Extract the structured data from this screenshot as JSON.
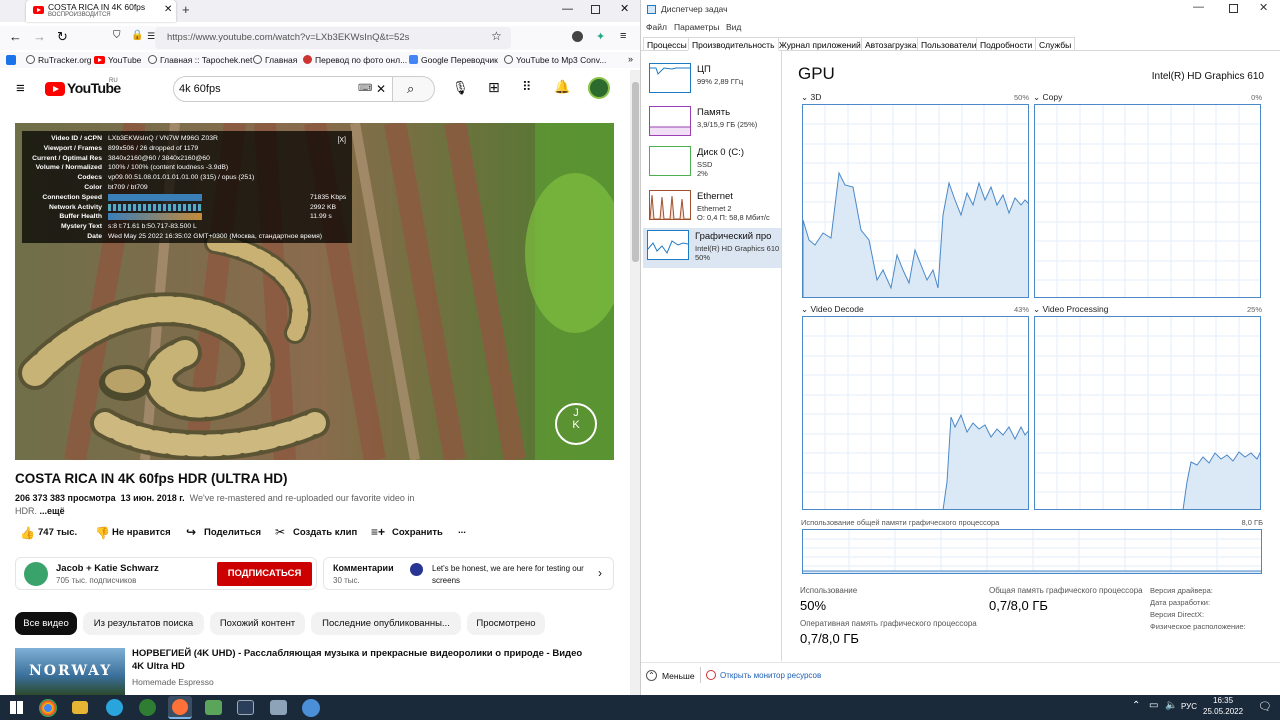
{
  "browser": {
    "tab_title": "COSTA RICA IN 4K 60fps HDR (",
    "tab_subtitle": "ВОСПРОИЗВОДИТСЯ",
    "url": "https://www.youtube.com/watch?v=LXb3EKWsInQ&t=52s",
    "bookmarks": [
      "RuTracker.org",
      "YouTube",
      "Главная :: Tapochek.net",
      "Главная",
      "Перевод по фото онл...",
      "Google Переводчик",
      "YouTube to Mp3 Conv..."
    ]
  },
  "youtube": {
    "logo": "YouTube",
    "logo_region": "RU",
    "search_value": "4k 60fps",
    "stats": [
      {
        "k": "Video ID / sCPN",
        "v": "LXb3EKWsInQ / VN7W M96G Z03R"
      },
      {
        "k": "Viewport / Frames",
        "v": "899x506 / 26 dropped of 1179"
      },
      {
        "k": "Current / Optimal Res",
        "v": "3840x2160@60 / 3840x2160@60"
      },
      {
        "k": "Volume / Normalized",
        "v": "100% / 100% (content loudness -3.9dB)"
      },
      {
        "k": "Codecs",
        "v": "vp09.00.51.08.01.01.01.01.00 (315) / opus (251)"
      },
      {
        "k": "Color",
        "v": "bt709 / bt709"
      },
      {
        "k": "Connection Speed",
        "v": "71835 Kbps"
      },
      {
        "k": "Network Activity",
        "v": "2992 KB"
      },
      {
        "k": "Buffer Health",
        "v": "11.99 s"
      },
      {
        "k": "Mystery Text",
        "v": "s:8 t:71.61 b:50.717-83.500 L"
      },
      {
        "k": "Date",
        "v": "Wed May 25 2022 16:35:02 GMT+0300 (Москва, стандартное время)"
      }
    ],
    "stats_close": "[X]",
    "watermark": "J K",
    "title": "COSTA RICA IN 4K 60fps HDR (ULTRA HD)",
    "views": "206 373 383 просмотра",
    "date": "13 июн. 2018 г.",
    "desc": "We've re-mastered and re-uploaded our favorite video in",
    "desc2": "HDR.",
    "more": "...ещё",
    "likes": "747 тыс.",
    "dislike": "Не нравится",
    "share": "Поделиться",
    "clip": "Создать клип",
    "save": "Сохранить",
    "more_dots": "...",
    "channel": "Jacob + Katie Schwarz",
    "subs": "705 тыс. подписчиков",
    "subscribe": "ПОДПИСАТЬСЯ",
    "comments_label": "Комментарии",
    "comments_count": "30 тыс.",
    "comment_text": "Let's be honest, we are here for testing our screens",
    "chips": [
      "Все видео",
      "Из результатов поиска",
      "Похожий контент",
      "Последние опубликованны...",
      "Просмотрено"
    ],
    "rec_title": "НОРВЕГИЕЙ (4K UHD) - Расслабляющая музыка и прекрасные видеоролики о природе - Видео 4K Ultra HD",
    "rec_channel": "Homemade Espresso",
    "rec_thumb_text": "NORWAY"
  },
  "taskmanager": {
    "title": "Диспетчер задач",
    "menu": [
      "Файл",
      "Параметры",
      "Вид"
    ],
    "tabs": [
      "Процессы",
      "Производительность",
      "Журнал приложений",
      "Автозагрузка",
      "Пользователи",
      "Подробности",
      "Службы"
    ],
    "side": [
      {
        "name": "ЦП",
        "s1": "99% 2,89 ГГц",
        "s2": "",
        "color": "#1f7ac4"
      },
      {
        "name": "Память",
        "s1": "3,9/15,9 ГБ (25%)",
        "s2": "",
        "color": "#9b3fb5"
      },
      {
        "name": "Диск 0 (C:)",
        "s1": "SSD",
        "s2": "2%",
        "color": "#4caf50"
      },
      {
        "name": "Ethernet",
        "s1": "Ethernet 2",
        "s2": "О: 0,4 П: 58,8 Мбит/с",
        "color": "#a0522d"
      },
      {
        "name": "Графический про",
        "s1": "Intel(R) HD Graphics 610",
        "s2": "50%",
        "color": "#1f7ac4"
      }
    ],
    "gpu_title": "GPU",
    "gpu_name": "Intel(R) HD Graphics 610",
    "graphs": [
      {
        "label": "3D",
        "pct": "50%"
      },
      {
        "label": "Copy",
        "pct": "0%"
      },
      {
        "label": "Video Decode",
        "pct": "43%"
      },
      {
        "label": "Video Processing",
        "pct": "25%"
      }
    ],
    "shared_label": "Использование общей памяти графического процессора",
    "shared_max": "8,0 ГБ",
    "usage_label": "Использование",
    "usage_value": "50%",
    "shared_mem_label": "Общая память графического процессора",
    "shared_mem_value": "0,7/8,0 ГБ",
    "dedicated_label": "Оперативная память графического процессора",
    "dedicated_value": "0,7/8,0 ГБ",
    "info": [
      "Версия драйвера:",
      "Дата разработки:",
      "Версия DirectX:",
      "Физическое расположение:"
    ],
    "fewer": "Меньше",
    "monitor": "Открыть монитор ресурсов"
  },
  "taskbar": {
    "lang": "РУС",
    "time": "16:35",
    "date": "25.05.2022"
  }
}
